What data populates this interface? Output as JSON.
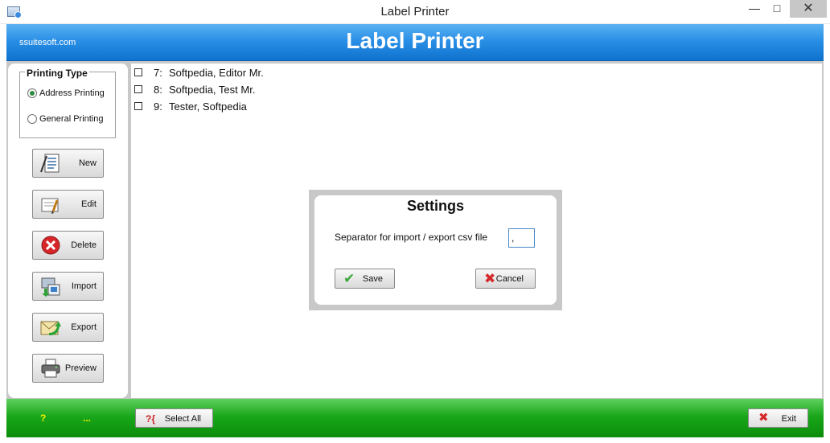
{
  "window": {
    "title": "Label Printer",
    "minimize_icon": "minimize-icon",
    "maximize_icon": "maximize-icon",
    "close_icon": "close-icon"
  },
  "header": {
    "site": "ssuitesoft.com",
    "title": "Label Printer",
    "color": "#2a8fe6"
  },
  "printing_type": {
    "legend": "Printing Type",
    "options": [
      {
        "label": "Address Printing",
        "selected": true
      },
      {
        "label": "General Printing",
        "selected": false
      }
    ]
  },
  "sidebar": {
    "buttons": [
      {
        "label": "New",
        "icon": "document-icon"
      },
      {
        "label": "Edit",
        "icon": "edit-icon"
      },
      {
        "label": "Delete",
        "icon": "delete-icon"
      },
      {
        "label": "Import",
        "icon": "import-icon"
      },
      {
        "label": "Export",
        "icon": "export-icon"
      },
      {
        "label": "Preview",
        "icon": "printer-icon"
      }
    ]
  },
  "list": {
    "items": [
      {
        "number": "7:",
        "name": "Softpedia, Editor Mr.",
        "checked": false
      },
      {
        "number": "8:",
        "name": "Softpedia, Test Mr.",
        "checked": false
      },
      {
        "number": "9:",
        "name": "Tester, Softpedia",
        "checked": false
      }
    ]
  },
  "settings_dialog": {
    "title": "Settings",
    "separator_label": "Separator for import / export csv file",
    "separator_value": ",",
    "save_label": "Save",
    "cancel_label": "Cancel"
  },
  "footer": {
    "help": "?",
    "more": "...",
    "select_all_label": "Select All",
    "exit_label": "Exit",
    "color": "#1aa71a",
    "accent_text_color": "#f2f200"
  }
}
